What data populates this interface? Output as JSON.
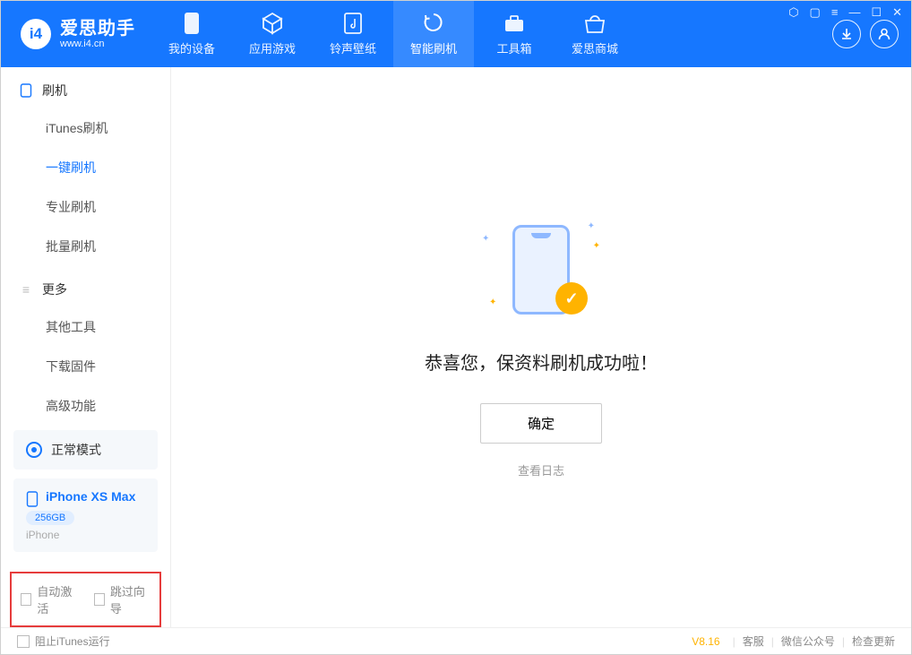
{
  "app": {
    "name": "爱思助手",
    "website": "www.i4.cn"
  },
  "nav": [
    {
      "id": "device",
      "label": "我的设备"
    },
    {
      "id": "apps",
      "label": "应用游戏"
    },
    {
      "id": "ringtone",
      "label": "铃声壁纸"
    },
    {
      "id": "flash",
      "label": "智能刷机"
    },
    {
      "id": "toolbox",
      "label": "工具箱"
    },
    {
      "id": "store",
      "label": "爱思商城"
    }
  ],
  "sidebar": {
    "group_flash": "刷机",
    "group_more": "更多",
    "items_flash": [
      {
        "id": "itunes",
        "label": "iTunes刷机"
      },
      {
        "id": "oneclick",
        "label": "一键刷机"
      },
      {
        "id": "pro",
        "label": "专业刷机"
      },
      {
        "id": "batch",
        "label": "批量刷机"
      }
    ],
    "items_more": [
      {
        "id": "tools",
        "label": "其他工具"
      },
      {
        "id": "firmware",
        "label": "下载固件"
      },
      {
        "id": "advanced",
        "label": "高级功能"
      }
    ],
    "mode": "正常模式",
    "device": {
      "name": "iPhone XS Max",
      "capacity": "256GB",
      "type": "iPhone"
    },
    "checkbox_auto_activate": "自动激活",
    "checkbox_skip_guide": "跳过向导"
  },
  "main": {
    "success_msg": "恭喜您，保资料刷机成功啦！",
    "ok_button": "确定",
    "view_log": "查看日志"
  },
  "footer": {
    "block_itunes": "阻止iTunes运行",
    "version": "V8.16",
    "support": "客服",
    "wechat": "微信公众号",
    "update": "检查更新"
  }
}
